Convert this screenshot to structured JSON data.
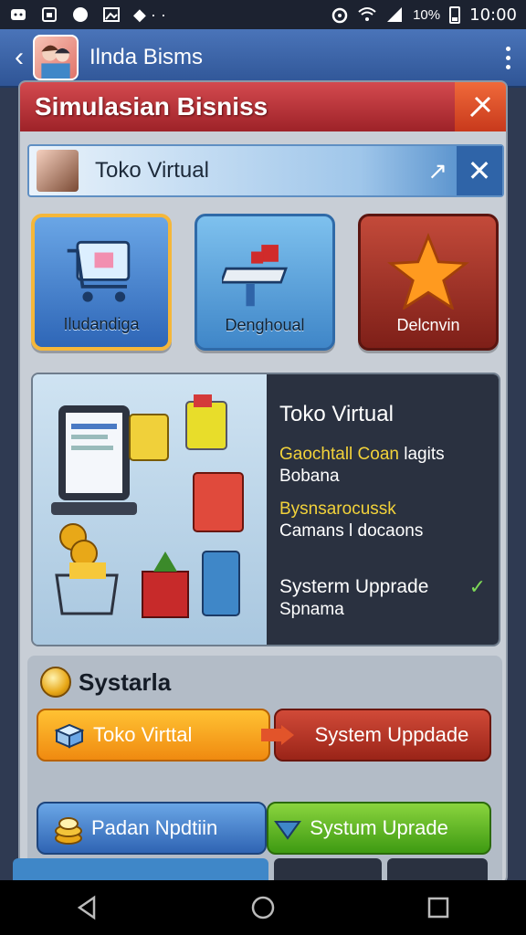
{
  "status_bar": {
    "time": "10:00",
    "battery_text": "10%",
    "icons": [
      "notification-icon",
      "calendar-icon",
      "chat-icon",
      "gallery-icon",
      "wifi-icon",
      "signal-icon",
      "battery-icon"
    ]
  },
  "app_bar": {
    "title": "Ilnda Bisms",
    "back_icon": "chevron-left-icon",
    "menu_icon": "more-vert-icon"
  },
  "panel": {
    "header_title": "Simulasian Bisniss",
    "close_icon": "close-icon",
    "sub_header": {
      "title": "Toko Virtual",
      "edit_icon": "edit-icon",
      "close_icon": "close-icon"
    },
    "tiles": [
      {
        "label": "Iludandiga",
        "icon": "cart-icon"
      },
      {
        "label": "Denghoual",
        "icon": "workbench-icon"
      },
      {
        "label": "Delcnvin",
        "icon": "star-icon"
      }
    ],
    "feature": {
      "title": "Toko Virtual",
      "line1_yellow": "Gaochtall Coan",
      "line1_white": "lagits",
      "line2": "Bobana",
      "line3": "Bysnsarocussk",
      "line4": "Camans l docaons",
      "line5": "Systerm Upprade",
      "line6": "Spnama"
    },
    "section2": {
      "title": "Systarla",
      "buttons": [
        {
          "label": "Toko Virttal"
        },
        {
          "label": "System Uppdade"
        },
        {
          "label": "Padan Npdtiin"
        },
        {
          "label": "Systum Uprade"
        }
      ]
    }
  },
  "colors": {
    "header_red": "#b8282e",
    "app_bar_blue": "#3b63a8",
    "accent_orange": "#f5a21b",
    "accent_green": "#5cb01c"
  }
}
